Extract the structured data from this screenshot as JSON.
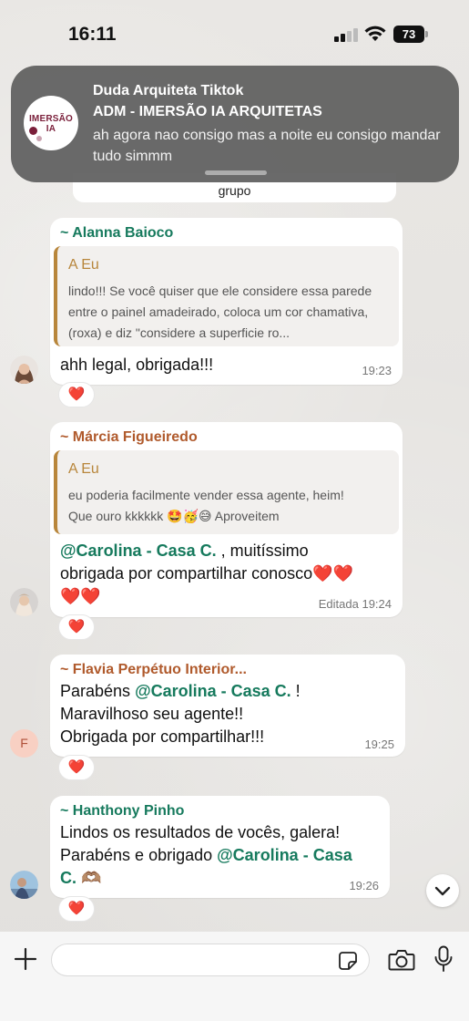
{
  "status_bar": {
    "time": "16:11",
    "battery": "73"
  },
  "notification": {
    "sender": "Duda Arquiteta Tiktok",
    "group": "ADM - IMERSÃO IA ARQUITETAS",
    "message": "ah agora nao consigo mas a noite eu consigo mandar tudo simmm",
    "avatar_text": "IMERSÃO IA"
  },
  "partial_message": {
    "text": "grupo"
  },
  "messages": [
    {
      "sender": "~ Alanna Baioco",
      "sender_color": "#167a5d",
      "quote_title": "A Eu",
      "quote_text": "lindo!!! Se você quiser que ele considere essa parede entre o painel amadeirado, coloca um cor chamativa, (roxa) e diz \"considere a superficie ro...",
      "text": "ahh legal, obrigada!!!",
      "time": "19:23",
      "reaction": "❤️"
    },
    {
      "sender": "~ Márcia Figueiredo",
      "sender_color": "#b05a2c",
      "quote_title": "A Eu",
      "quote_text_1": "eu poderia facilmente vender essa agente, heim!",
      "quote_text_2": "Que ouro kkkkkk 🤩🥳😅 Aproveitem",
      "mention": "@Carolina - Casa C.",
      "text_1": " ,  muitíssimo",
      "text_2": "obrigada por compartilhar conosco",
      "text_hearts": "❤️❤️",
      "text_hearts_2": "❤️❤️",
      "time": "Editada 19:24",
      "reaction": "❤️"
    },
    {
      "sender": "~ Flavia Perpétuo Interior...",
      "sender_color": "#b05a2c",
      "line_1_prefix": "Parabéns ",
      "mention": "@Carolina - Casa C.",
      "line_1_suffix": " !",
      "line_2": "Maravilhoso seu agente!!",
      "line_3": "Obrigada por compartilhar!!!",
      "time": "19:25",
      "avatar_letter": "F",
      "reaction": "❤️"
    },
    {
      "sender": "~ Hanthony Pinho",
      "sender_color": "#167a5d",
      "line_1": "Lindos os resultados de vocês, galera!",
      "line_2_prefix": "Parabéns e obrigado ",
      "mention_1": "@Carolina - Casa",
      "mention_2": "C.",
      "line_3_suffix": " 🫶🏽",
      "time": "19:26",
      "reaction": "❤️"
    }
  ],
  "icons": {
    "plus": "plus-icon",
    "sticker": "sticker-icon",
    "camera": "camera-icon",
    "mic": "microphone-icon",
    "scroll": "chevron-down-icon"
  }
}
